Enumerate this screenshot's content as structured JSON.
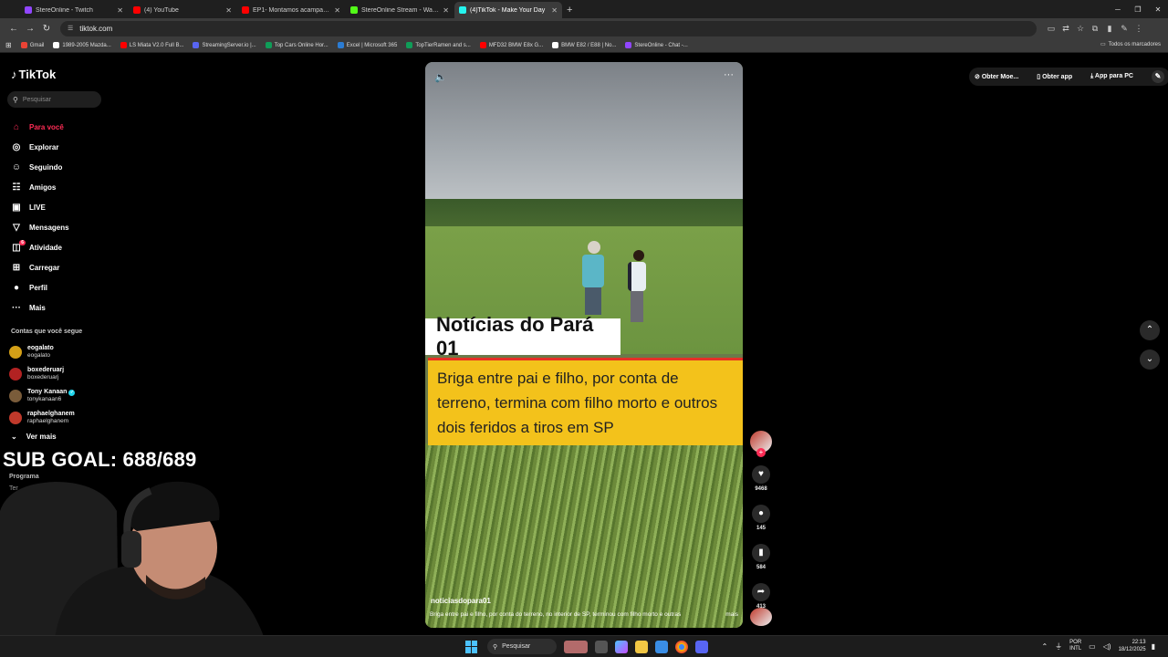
{
  "browser": {
    "tabs": [
      {
        "title": "StereOnline - Twitch",
        "color": "#9146ff"
      },
      {
        "title": "(4) YouTube",
        "color": "#ff0000"
      },
      {
        "title": "EP1- Montamos acampamento...",
        "color": "#ff0000"
      },
      {
        "title": "StereOnline Stream - Watch Li...",
        "color": "#53fc18"
      },
      {
        "title": "(4)TikTok - Make Your Day",
        "color": "#25f4ee"
      }
    ],
    "url": "tiktok.com",
    "bookmarks": [
      {
        "label": "Gmail",
        "color": "#ea4335"
      },
      {
        "label": "1989-2005 Mazda...",
        "color": "#ffffff"
      },
      {
        "label": "LS Miata V2.0 Full B...",
        "color": "#ff0000"
      },
      {
        "label": "StreamingServer.io |...",
        "color": "#5865f2"
      },
      {
        "label": "Top Cars Online Hor...",
        "color": "#0f9d58"
      },
      {
        "label": "Excel | Microsoft 365",
        "color": "#2b7cd3"
      },
      {
        "label": "TopTierRamen and s...",
        "color": "#0f9d58"
      },
      {
        "label": "MFD32 BMW E8x G...",
        "color": "#ff0000"
      },
      {
        "label": "BMW E82 / E88 | No...",
        "color": "#ffffff"
      },
      {
        "label": "StereOnline - Chat -...",
        "color": "#9146ff"
      }
    ],
    "all_bookmarks": "Todos os marcadores"
  },
  "tiktok": {
    "logo": "TikTok",
    "search_placeholder": "Pesquisar",
    "nav": [
      {
        "label": "Para você",
        "icon": "home-icon",
        "active": true
      },
      {
        "label": "Explorar",
        "icon": "compass-icon"
      },
      {
        "label": "Seguindo",
        "icon": "following-icon"
      },
      {
        "label": "Amigos",
        "icon": "friends-icon"
      },
      {
        "label": "LIVE",
        "icon": "live-icon"
      },
      {
        "label": "Mensagens",
        "icon": "messages-icon"
      },
      {
        "label": "Atividade",
        "icon": "activity-icon",
        "badge": "6"
      },
      {
        "label": "Carregar",
        "icon": "upload-icon"
      },
      {
        "label": "Perfil",
        "icon": "profile-icon"
      },
      {
        "label": "Mais",
        "icon": "more-icon"
      }
    ],
    "following_heading": "Contas que você segue",
    "accounts": [
      {
        "name": "eogalato",
        "handle": "eogalato",
        "color": "#d4a017"
      },
      {
        "name": "boxederuarj",
        "handle": "boxederuarj",
        "color": "#b22222"
      },
      {
        "name": "Tony Kanaan",
        "handle": "tonykanaan6",
        "color": "#7a5c3a",
        "verified": true
      },
      {
        "name": "raphaelghanem",
        "handle": "raphaelghanem",
        "color": "#c0392b"
      }
    ],
    "see_more": "Ver mais",
    "footer_partial": "Programa",
    "footer_partial2": "Ter",
    "top_actions": {
      "effects": "Obter Moe...",
      "app": "Obter app",
      "pc": "App para PC"
    }
  },
  "overlay": {
    "sub_goal": "SUB GOAL: 688/689"
  },
  "video": {
    "title_card": "Notícias do Pará 01",
    "headline": "Briga entre pai e filho, por conta de terreno, termina com filho morto e outros dois feridos a tiros em SP",
    "username": "noticiasdopara01",
    "caption": "Briga entre pai e filho, por conta do terreno, no interior de SP, terminou com filho morto e outras",
    "more": "mais"
  },
  "actions": {
    "likes": "9468",
    "comments": "145",
    "saves": "584",
    "shares": "413"
  },
  "taskbar": {
    "search": "Pesquisar",
    "lang1": "POR",
    "lang2": "INTL",
    "time": "22:13",
    "date": "18/12/2025"
  }
}
